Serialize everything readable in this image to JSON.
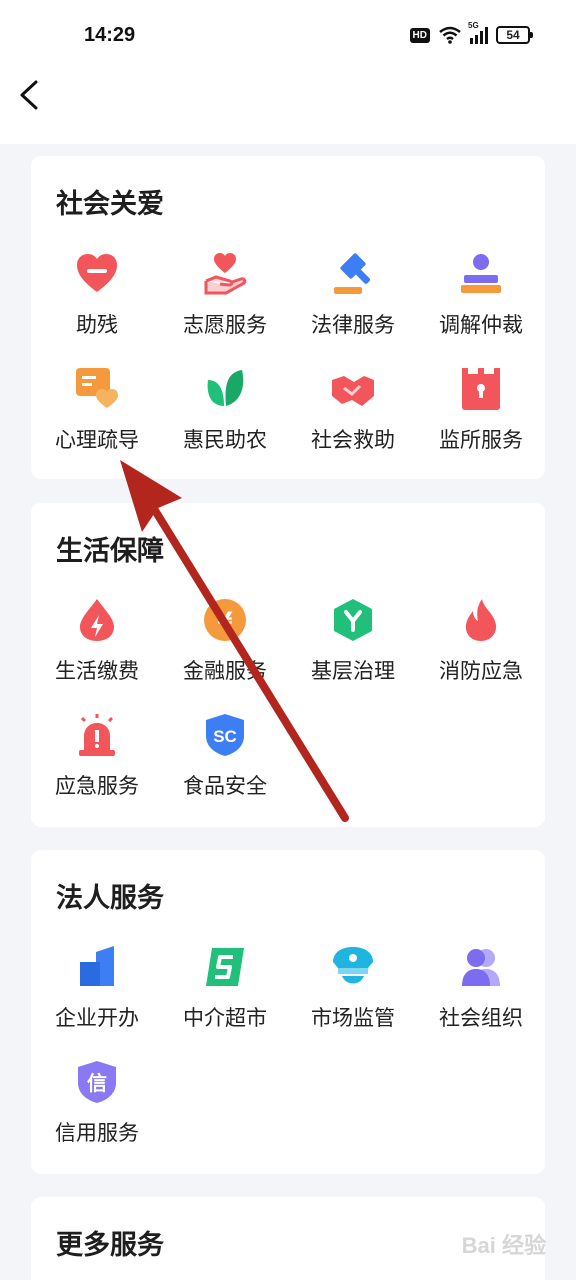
{
  "status": {
    "time": "14:29",
    "hd": "HD",
    "network": "5G",
    "battery": "54"
  },
  "sections": [
    {
      "title": "社会关爱",
      "items": [
        "助残",
        "志愿服务",
        "法律服务",
        "调解仲裁",
        "心理疏导",
        "惠民助农",
        "社会救助",
        "监所服务"
      ]
    },
    {
      "title": "生活保障",
      "items": [
        "生活缴费",
        "金融服务",
        "基层治理",
        "消防应急",
        "应急服务",
        "食品安全"
      ]
    },
    {
      "title": "法人服务",
      "items": [
        "企业开办",
        "中介超市",
        "市场监管",
        "社会组织",
        "信用服务"
      ]
    },
    {
      "title": "更多服务",
      "items": []
    }
  ],
  "icons": {
    "fin_glyph": "¥",
    "food_glyph": "SC",
    "credit_glyph": "信"
  },
  "colors": {
    "red": "#f2555a",
    "blue": "#3d7ef5",
    "green": "#21c07a",
    "purple": "#7b6cf0",
    "orange": "#f59a3c",
    "annotation": "#b3261e"
  },
  "watermark": "Bai 经验"
}
